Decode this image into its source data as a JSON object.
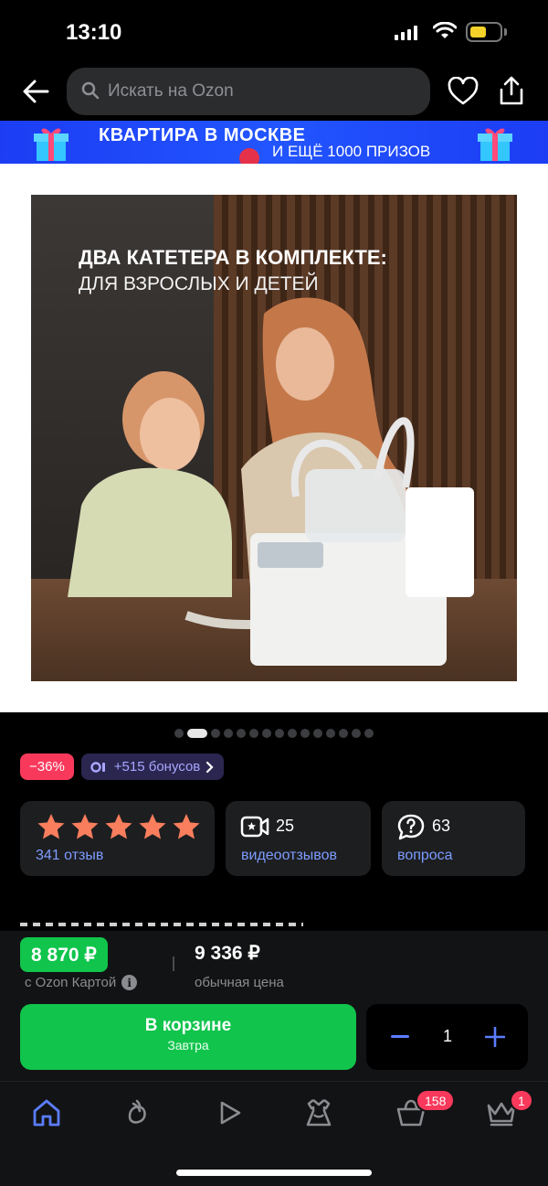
{
  "status_bar": {
    "time": "13:10",
    "battery_color": "#f5d22a"
  },
  "header": {
    "search_placeholder": "Искать на Ozon",
    "icons": [
      "back-arrow-icon",
      "search-icon",
      "heart-icon",
      "share-icon"
    ]
  },
  "banner": {
    "line1": "КВАРТИРА В МОСКВЕ",
    "line2": "И ЕЩЁ 1000 ПРИЗОВ",
    "background": "#1c3df4"
  },
  "product_image": {
    "headline": "ДВА КАТЕТЕРА В КОМПЛЕКТЕ:",
    "subheadline": "ДЛЯ ВЗРОСЛЫХ И ДЕТЕЙ"
  },
  "gallery_dots": {
    "active_index": 1
  },
  "tags": {
    "discount": "−36%",
    "bonus": "+515 бонусов"
  },
  "rating": {
    "stars": 5,
    "reviews_label": "341 отзыв",
    "star_color": "#f87e5d"
  },
  "videos": {
    "count": "25",
    "label": "видеоотзывов"
  },
  "questions": {
    "count": "63",
    "label": "вопроса"
  },
  "price": {
    "ozon_card_price": "8 870 ₽",
    "ozon_card_label": "с Ozon Картой",
    "regular_price": "9 336 ₽",
    "regular_label": "обычная цена",
    "accent": "#10c44c"
  },
  "cart": {
    "button_label": "В корзине",
    "delivery": "Завтра",
    "quantity": "1"
  },
  "tabbar": {
    "tabs": [
      "home-icon",
      "fresh-icon",
      "video-icon",
      "fashion-icon",
      "cart-icon",
      "premium-crown-icon"
    ],
    "cart_badge": "158",
    "premium_badge": "1",
    "active_color": "#5b7dff"
  }
}
